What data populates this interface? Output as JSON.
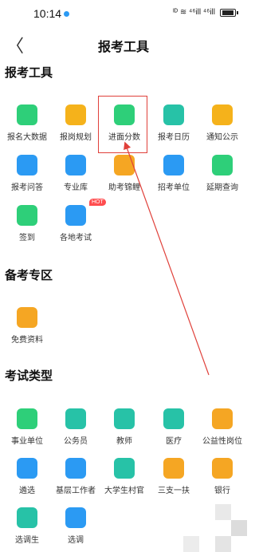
{
  "status": {
    "time": "10:14",
    "icons": "ᴵᴰ  ≋  ⁴⁶ill  ⁴⁶ill"
  },
  "nav": {
    "back": "〈",
    "title": "报考工具"
  },
  "sections": {
    "tools": "报考工具",
    "prep": "备考专区",
    "types": "考试类型"
  },
  "tools": [
    {
      "label": "报名大数据",
      "icon": "bar-chart-icon",
      "color": "#2ecf79"
    },
    {
      "label": "报岗规划",
      "icon": "target-icon",
      "color": "#f5b21b"
    },
    {
      "label": "进面分数",
      "icon": "score-card-icon",
      "color": "#2ecf79"
    },
    {
      "label": "报考日历",
      "icon": "calendar-icon",
      "color": "#27c2a7"
    },
    {
      "label": "通知公示",
      "icon": "notice-icon",
      "color": "#f5b21b"
    },
    {
      "label": "报考问答",
      "icon": "chat-icon",
      "color": "#2b9af3"
    },
    {
      "label": "专业库",
      "icon": "graduation-cap-icon",
      "color": "#2b9af3"
    },
    {
      "label": "助考锦鲤",
      "icon": "koi-icon",
      "color": "#f5a623"
    },
    {
      "label": "招考单位",
      "icon": "building-icon",
      "color": "#2b9af3"
    },
    {
      "label": "延期查询",
      "icon": "search-doc-icon",
      "color": "#2ecf79"
    },
    {
      "label": "签到",
      "icon": "checkin-icon",
      "color": "#2ecf79"
    },
    {
      "label": "各地考试",
      "icon": "region-exam-icon",
      "color": "#2b9af3",
      "badge": "HOT"
    }
  ],
  "prep": [
    {
      "label": "免费资料",
      "icon": "book-icon",
      "color": "#f5a623"
    }
  ],
  "types": [
    {
      "label": "事业单位",
      "icon": "institution-icon",
      "color": "#2ecf79"
    },
    {
      "label": "公务员",
      "icon": "civil-servant-icon",
      "color": "#27c2a7"
    },
    {
      "label": "教师",
      "icon": "teacher-icon",
      "color": "#27c2a7"
    },
    {
      "label": "医疗",
      "icon": "medical-kit-icon",
      "color": "#27c2a7"
    },
    {
      "label": "公益性岗位",
      "icon": "handshake-icon",
      "color": "#f5a623"
    },
    {
      "label": "遴选",
      "icon": "upload-icon",
      "color": "#2b9af3"
    },
    {
      "label": "基层工作者",
      "icon": "worker-icon",
      "color": "#2b9af3"
    },
    {
      "label": "大学生村官",
      "icon": "graduate-icon",
      "color": "#27c2a7"
    },
    {
      "label": "三支一扶",
      "icon": "heart-hands-icon",
      "color": "#f5a623"
    },
    {
      "label": "银行",
      "icon": "bank-icon",
      "color": "#f5a623"
    },
    {
      "label": "选调生",
      "icon": "selected-graduate-icon",
      "color": "#27c2a7"
    },
    {
      "label": "选调",
      "icon": "transfer-icon",
      "color": "#2b9af3"
    }
  ]
}
